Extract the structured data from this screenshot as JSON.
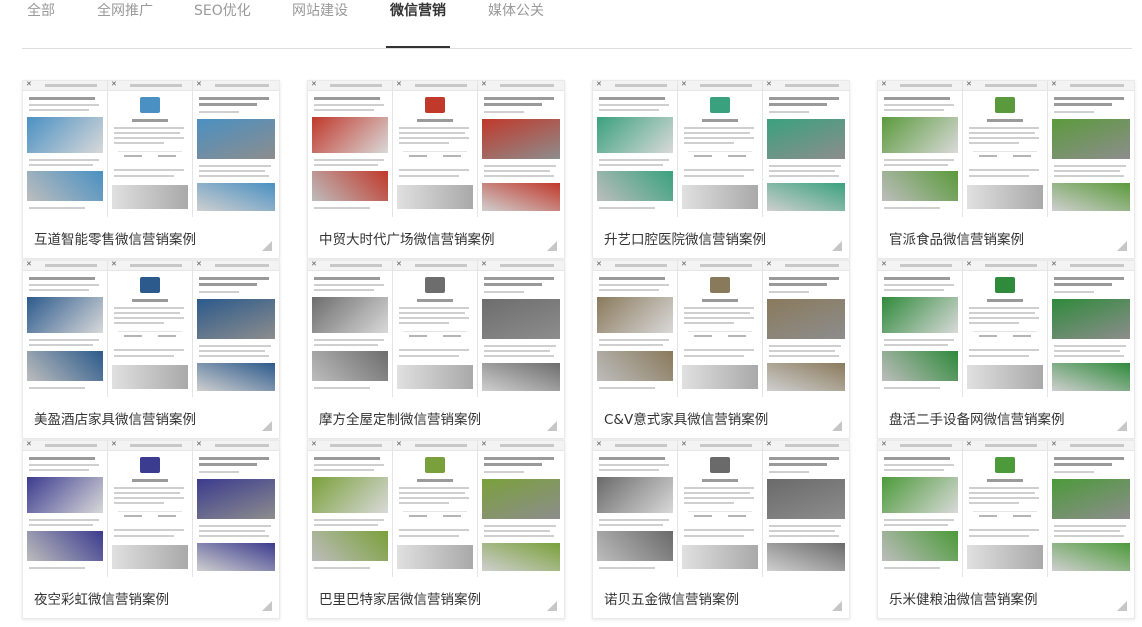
{
  "tabs": [
    {
      "label": "全部",
      "active": false
    },
    {
      "label": "全网推广",
      "active": false
    },
    {
      "label": "SEO优化",
      "active": false
    },
    {
      "label": "网站建设",
      "active": false
    },
    {
      "label": "微信营销",
      "active": true
    },
    {
      "label": "媒体公关",
      "active": false
    }
  ],
  "cases": [
    {
      "title": "互道智能零售微信营销案例",
      "accent": "#4a90c2"
    },
    {
      "title": "中贸大时代广场微信营销案例",
      "accent": "#c0392b"
    },
    {
      "title": "升艺口腔医院微信营销案例",
      "accent": "#3aa17e"
    },
    {
      "title": "官派食品微信营销案例",
      "accent": "#5b9a3c"
    },
    {
      "title": "美盈酒店家具微信营销案例",
      "accent": "#2c5a8c"
    },
    {
      "title": "摩方全屋定制微信营销案例",
      "accent": "#6d6d6d"
    },
    {
      "title": "C&V意式家具微信营销案例",
      "accent": "#8a7a5c"
    },
    {
      "title": "盘活二手设备网微信营销案例",
      "accent": "#2f8a3b"
    },
    {
      "title": "夜空彩虹微信营销案例",
      "accent": "#3b3b8f"
    },
    {
      "title": "巴里巴特家居微信营销案例",
      "accent": "#7aa03b"
    },
    {
      "title": "诺贝五金微信营销案例",
      "accent": "#6a6a6a"
    },
    {
      "title": "乐米健粮油微信营销案例",
      "accent": "#4c9a3a"
    }
  ]
}
